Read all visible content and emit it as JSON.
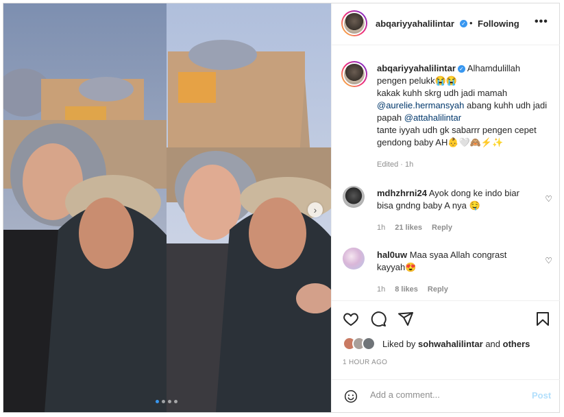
{
  "post": {
    "author": "abqariyyahalilintar",
    "follow_status": "Following",
    "separator": "•",
    "more_label": "•••",
    "caption_lines": [
      "Alhamdulillah pengen pelukk😭😭",
      "kakak kuhh skrg udh jadi mamah",
      "abang kuhh udh jadi papah",
      "tante iyyah udh gk sabarrr pengen cepet gendong baby AH👶🤍🙈⚡✨"
    ],
    "mentions": [
      "@aurelie.hermansyah",
      "@attahalilintar"
    ],
    "caption_meta": "Edited · 1h",
    "carousel": {
      "slide_count": 4,
      "active_index": 0,
      "next_icon": "›"
    }
  },
  "comments": [
    {
      "user": "mdhzhrni24",
      "text": "Ayok dong ke indo biar bisa gndng baby A nya 🤤",
      "time": "1h",
      "likes": "21 likes",
      "reply": "Reply"
    },
    {
      "user": "hal0uw",
      "text": "Maa syaa Allah congrast kayyah😍",
      "time": "1h",
      "likes": "8 likes",
      "reply": "Reply"
    }
  ],
  "likes": {
    "prefix": "Liked by",
    "user": "sohwahalilintar",
    "connector": "and",
    "suffix": "others"
  },
  "time_ago": "1 HOUR AGO",
  "add_comment": {
    "placeholder": "Add a comment...",
    "post_label": "Post"
  },
  "icons": {
    "verified": "✓",
    "heart_small": "♡",
    "like": "heart-icon",
    "comment": "comment-icon",
    "share": "share-icon",
    "save": "bookmark-icon",
    "emoji": "smiley-icon"
  },
  "colors": {
    "link": "#00376b",
    "verified": "#3897f0",
    "post_disabled": "#b2dffc",
    "meta": "#8e8e8e"
  }
}
